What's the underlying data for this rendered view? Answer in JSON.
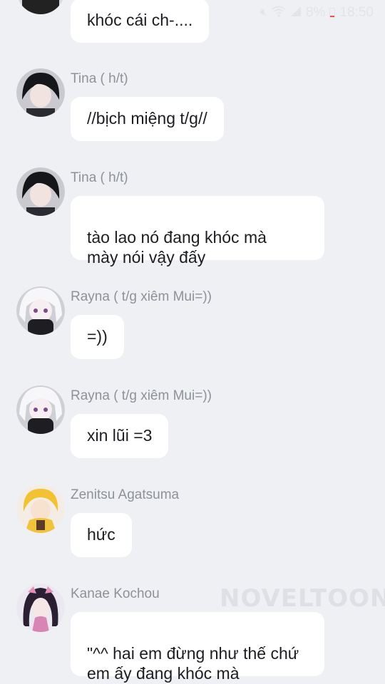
{
  "status_bar": {
    "battery_percent": "8%",
    "time": "18:50",
    "icons": [
      "mute-icon",
      "wifi-icon",
      "signal-icon",
      "battery-icon"
    ]
  },
  "watermark": "NOVELTOON",
  "messages": [
    {
      "sender": "",
      "text": "khóc cái ch-....",
      "avatar": "white-hair-girl-avatar"
    },
    {
      "sender": "Tina ( h/t)",
      "text": "//bịch miệng t/g//",
      "avatar": "dark-hair-boy-avatar"
    },
    {
      "sender": "Tina ( h/t)",
      "text": "tào lao nó đang khóc mà\nmày nói vậy đấy",
      "avatar": "dark-hair-boy-avatar"
    },
    {
      "sender": "Rayna ( t/g xiêm Mui=))",
      "text": "=))",
      "avatar": "white-hair-girl-avatar"
    },
    {
      "sender": "Rayna ( t/g xiêm Mui=))",
      "text": "xin lũi =3",
      "avatar": "white-hair-girl-avatar"
    },
    {
      "sender": "Zenitsu Agatsuma",
      "text": "hức",
      "avatar": "blonde-boy-avatar"
    },
    {
      "sender": "Kanae Kochou",
      "text": "\"^^ hai em đừng như thế chứ\nem ấy đang khóc mà",
      "avatar": "butterfly-girl-avatar"
    }
  ]
}
